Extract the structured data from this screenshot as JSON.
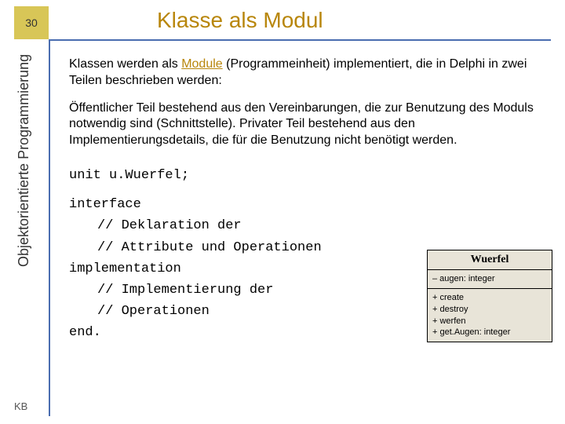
{
  "page_number": "30",
  "title": "Klasse als Modul",
  "sidebar_text": "Objektorientierte Programmierung",
  "footer_label": "KB",
  "para1_pre": "Klassen werden als ",
  "para1_highlight": "Module",
  "para1_post": " (Programmeinheit) implementiert, die in Delphi in zwei Teilen beschrieben werden:",
  "para2": "Öffentlicher Teil bestehend aus den Vereinbarungen, die zur Benutzung des Moduls notwendig sind (Schnittstelle). Privater Teil bestehend aus den Implementierungsdetails, die für die Benutzung nicht benötigt werden.",
  "code": {
    "l1": "unit u.Wuerfel;",
    "l2": "interface",
    "l3": "// Deklaration der",
    "l4": "// Attribute und Operationen",
    "l5": "implementation",
    "l6": "// Implementierung der",
    "l7": "// Operationen",
    "l8": "end."
  },
  "uml": {
    "name": "Wuerfel",
    "attr1": "– augen: integer",
    "op1": "+ create",
    "op2": "+ destroy",
    "op3": "+ werfen",
    "op4": "+ get.Augen: integer"
  }
}
